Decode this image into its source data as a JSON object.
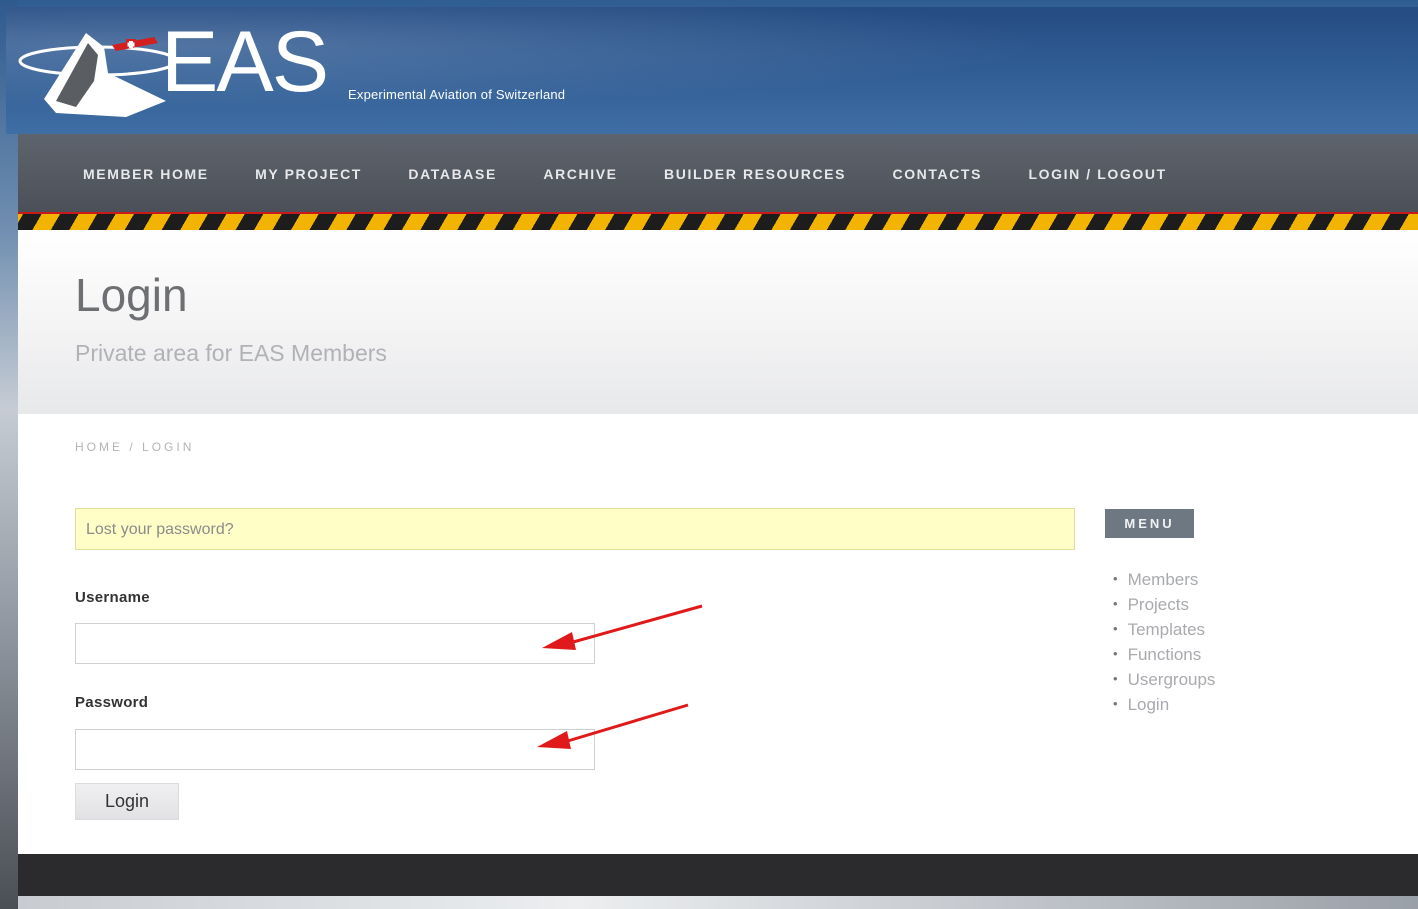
{
  "site": {
    "logo_text": "EAS",
    "logo_subtitle": "Experimental Aviation of Switzerland"
  },
  "nav": {
    "items": [
      {
        "label": "MEMBER HOME"
      },
      {
        "label": "MY PROJECT"
      },
      {
        "label": "DATABASE"
      },
      {
        "label": "ARCHIVE"
      },
      {
        "label": "BUILDER RESOURCES"
      },
      {
        "label": "CONTACTS"
      },
      {
        "label": "LOGIN / LOGOUT"
      }
    ]
  },
  "page": {
    "title": "Login",
    "subtitle": "Private area for EAS Members"
  },
  "breadcrumb": {
    "home": "HOME",
    "separator": "/",
    "current": "LOGIN"
  },
  "form": {
    "lost_password": "Lost your password?",
    "username_label": "Username",
    "username_value": "",
    "password_label": "Password",
    "password_value": "",
    "submit_label": "Login"
  },
  "sidebar": {
    "menu_title": "MENU",
    "items": [
      {
        "label": "Members"
      },
      {
        "label": "Projects"
      },
      {
        "label": "Templates"
      },
      {
        "label": "Functions"
      },
      {
        "label": "Usergroups"
      },
      {
        "label": "Login"
      }
    ]
  },
  "colors": {
    "nav_bg": "#50555d",
    "hazard_yellow": "#f2b400",
    "hazard_red": "#c81a1a",
    "notice_bg": "#fefec6",
    "menu_badge_bg": "#6d7883",
    "annotation_arrow": "#e01a1a",
    "footer_bg": "#2b2b2d"
  },
  "icons": {
    "logo": "aircraft-logo-icon",
    "annotation": "red-arrow-icon"
  }
}
